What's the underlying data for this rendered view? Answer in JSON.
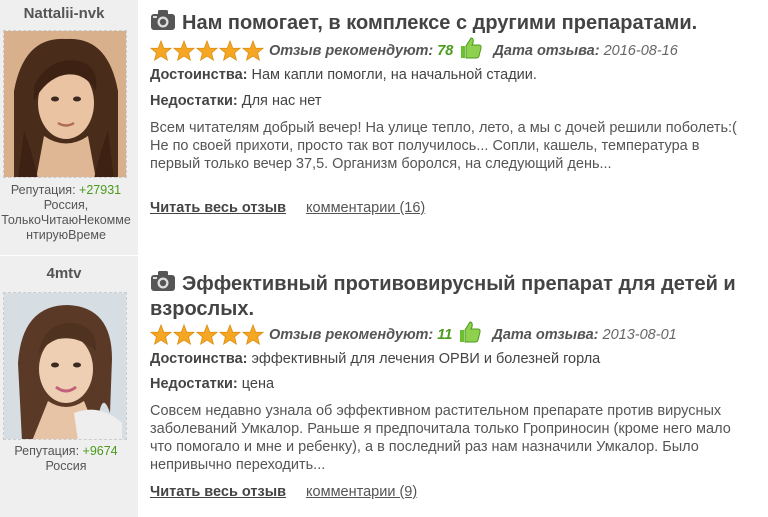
{
  "labels": {
    "reputation": "Репутация:",
    "pros": "Достоинства:",
    "cons": "Недостатки:",
    "recommend": "Отзыв рекомендуют:",
    "date": "Дата отзыва:",
    "read_full": "Читать весь отзыв"
  },
  "reviews": [
    {
      "username": "Nattalii-nvk",
      "reputation": "+27931",
      "location": "Россия,",
      "status": "ТолькоЧитаюНекомментируюВреме",
      "title": "Нам помогает, в комплексе с другими препаратами.",
      "stars": 5,
      "recommend_count": "78",
      "date": "2016-08-16",
      "pros": "Нам капли помогли, на начальной стадии.",
      "cons": "Для нас нет",
      "text": "Всем читателям добрый вечер! На улице тепло, лето, а мы с дочей решили поболеть:( Не по своей прихоти, просто так вот получилось... Сопли, кашель, температура в первый только вечер 37,5. Организм боролся, на следующий день...",
      "comments": "комментарии (16)"
    },
    {
      "username": "4mtv",
      "reputation": "+9674",
      "location": "Россия",
      "status": "",
      "title": "Эффективный противовирусный препарат для детей и взрослых.",
      "stars": 5,
      "recommend_count": "11",
      "date": "2013-08-01",
      "pros": "эффективный для лечения ОРВИ и болезней горла",
      "cons": "цена",
      "text": "Совсем недавно узнала об эффективном растительном препарате против вирусных заболеваний Умкалор. Раньше я предпочитала только Гроприносин (кроме него мало что помогало и мне и ребенку), а в последний раз нам назначили Умкалор. Было непривычно переходить...",
      "comments": "комментарии (9)"
    }
  ],
  "colors": {
    "star": "#f5a623",
    "positive": "#4a9a1c",
    "sidebar": "#efefef"
  },
  "icons": [
    "camera-icon",
    "star-icon",
    "thumbs-up-icon"
  ]
}
